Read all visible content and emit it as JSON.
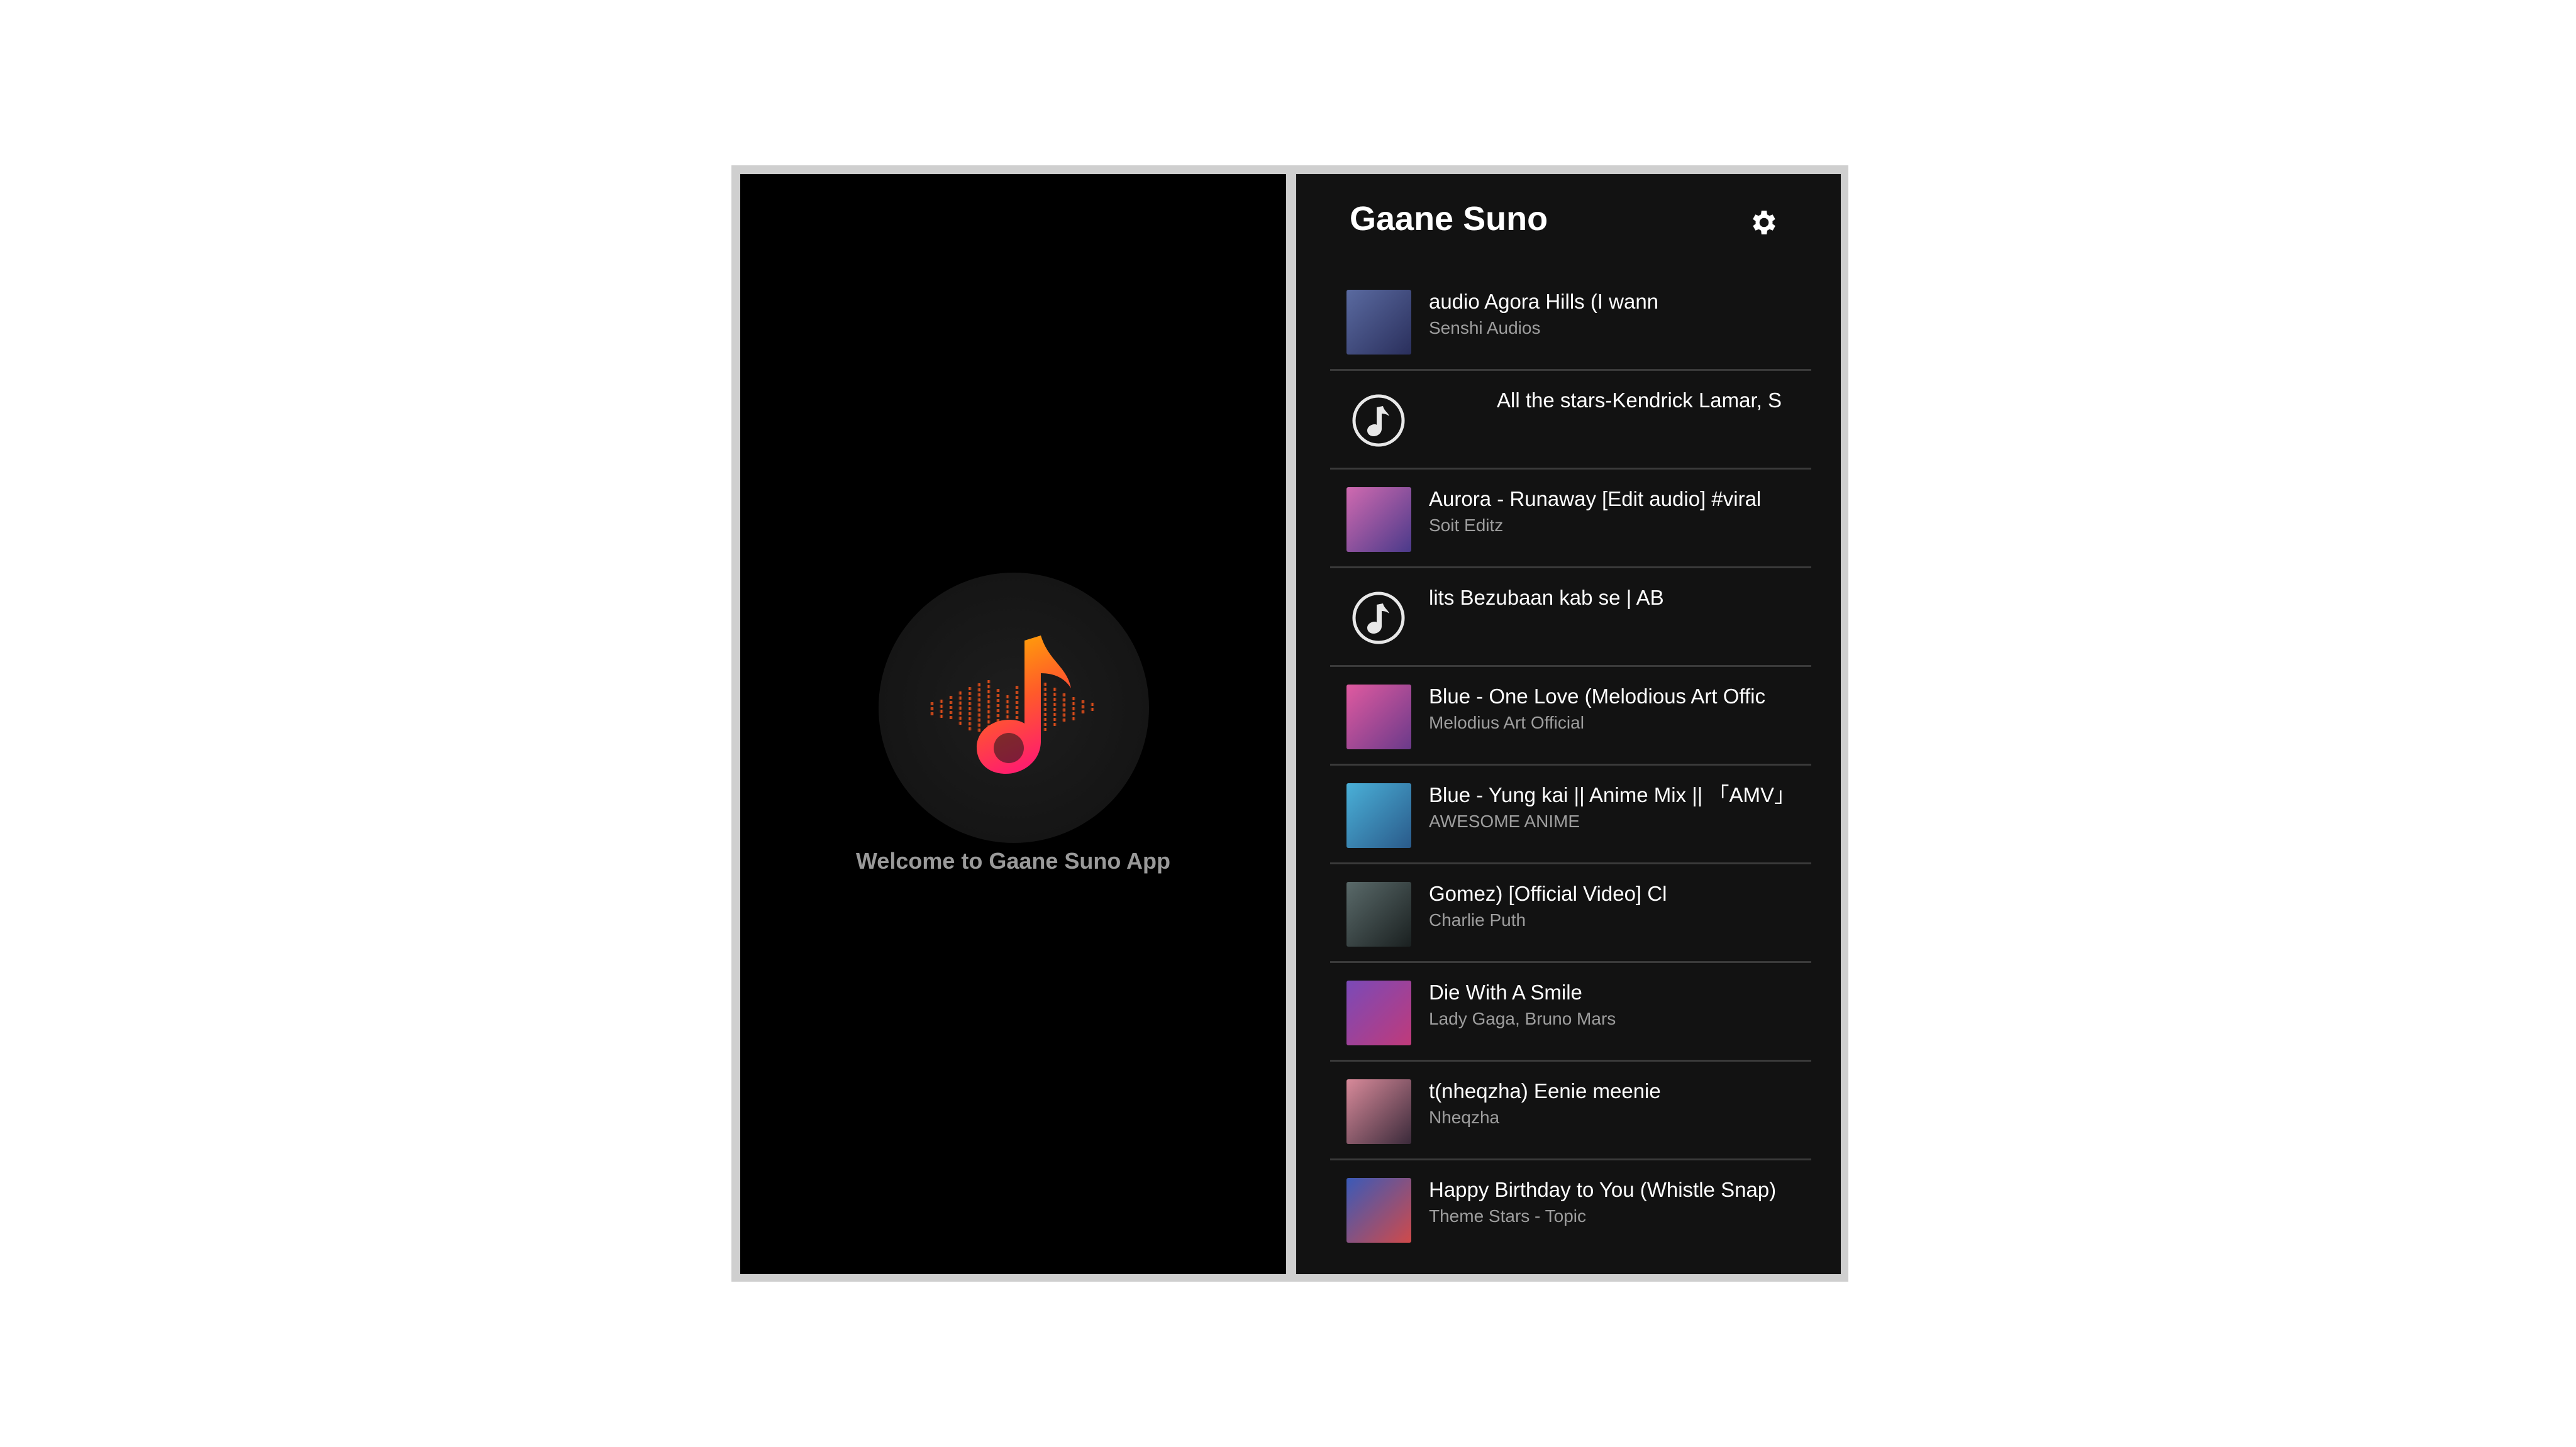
{
  "splash": {
    "welcome_text": "Welcome to Gaane Suno App",
    "logo_icon": "music-note-equalizer-icon"
  },
  "list_screen": {
    "app_title": "Gaane Suno",
    "settings_icon": "gear-icon",
    "songs": [
      {
        "title": "audio           Agora Hills (I wann",
        "artist": "Senshi Audios",
        "thumbnail": "image",
        "colors": [
          "#5a6aa0",
          "#2a2f5c"
        ]
      },
      {
        "title": "All the stars-Kendrick Lamar, S",
        "artist": "",
        "thumbnail": "music-note-icon",
        "colors": []
      },
      {
        "title": "Aurora - Runaway [Edit audio] #viral",
        "artist": "Soit Editz",
        "thumbnail": "image",
        "colors": [
          "#d06ab0",
          "#4a3a8a"
        ]
      },
      {
        "title": "lits          Bezubaan kab se | AB",
        "artist": "",
        "thumbnail": "music-note-icon",
        "colors": []
      },
      {
        "title": "Blue - One Love (Melodious Art Offic",
        "artist": "Melodius Art Official",
        "thumbnail": "image",
        "colors": [
          "#e05aa0",
          "#6a3a8a"
        ]
      },
      {
        "title": "Blue - Yung kai || Anime Mix || 「AMV」",
        "artist": "AWESOME ANIME",
        "thumbnail": "image",
        "colors": [
          "#4ab0d8",
          "#2a5a8a"
        ]
      },
      {
        "title": "Gomez) [Official Video]            Cl",
        "artist": "Charlie Puth",
        "thumbnail": "image",
        "colors": [
          "#5a6a6a",
          "#1a2020"
        ]
      },
      {
        "title": "Die With A Smile",
        "artist": "Lady Gaga, Bruno Mars",
        "thumbnail": "image",
        "colors": [
          "#7a4ab8",
          "#c03a7a"
        ]
      },
      {
        "title": "t(nheqzha)           Eenie meenie",
        "artist": "Nheqzha",
        "thumbnail": "image",
        "colors": [
          "#d88a9a",
          "#3a2a3a"
        ]
      },
      {
        "title": "Happy Birthday to You (Whistle Snap)",
        "artist": "Theme Stars - Topic",
        "thumbnail": "image",
        "colors": [
          "#3a5ab8",
          "#d04a4a"
        ]
      }
    ]
  },
  "colors": {
    "accent_start": "#ffb300",
    "accent_end": "#ff1f6b",
    "background_dark": "#121212"
  }
}
